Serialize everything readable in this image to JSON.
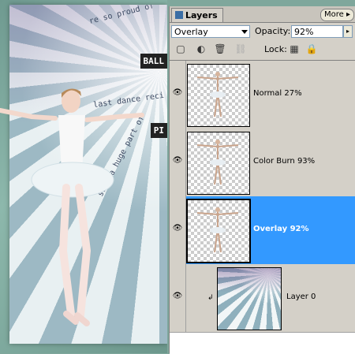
{
  "canvas": {
    "stamps": [
      "BALL",
      "PI"
    ],
    "quotes": [
      "re so proud of",
      "last dance reci",
      "such a huge part of"
    ]
  },
  "panel": {
    "tab_label": "Layers",
    "more_label": "More",
    "blend_mode": "Overlay",
    "opacity_label": "Opacity:",
    "opacity_value": "92%",
    "lock_label": "Lock:",
    "layers": [
      {
        "name": "Normal 27%",
        "selected": false,
        "thumb": "dancer"
      },
      {
        "name": "Color Burn 93%",
        "selected": false,
        "thumb": "dancer"
      },
      {
        "name": "Overlay 92%",
        "selected": true,
        "thumb": "dancer"
      },
      {
        "name": "Layer 0",
        "selected": false,
        "thumb": "burst",
        "clipped": true
      }
    ]
  },
  "colors": {
    "selection": "#3399ff",
    "panel_bg": "#d4d0c8",
    "frame_bg": "#7fa79c"
  },
  "icons": [
    "eye-icon",
    "lock-transparent-icon",
    "lock-all-icon",
    "link-icon",
    "trash-icon",
    "clip-arrow-icon"
  ]
}
